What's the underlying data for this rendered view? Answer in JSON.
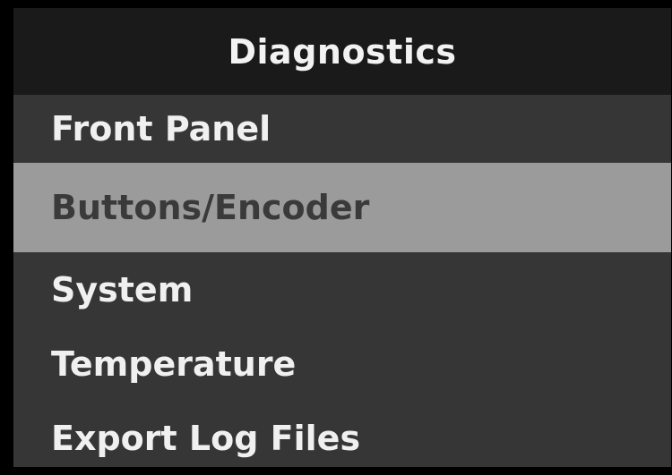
{
  "header": {
    "title": "Diagnostics"
  },
  "menu": {
    "items": [
      {
        "label": "Front Panel"
      },
      {
        "label": "Buttons/Encoder",
        "selected": true
      },
      {
        "label": "System"
      },
      {
        "label": "Temperature"
      },
      {
        "label": "Export Log Files"
      }
    ]
  },
  "colors": {
    "background": "#000000",
    "panel": "#363636",
    "header": "#1a1a1a",
    "selected": "#9b9b9b",
    "text": "#f0f0f0",
    "selected_text": "#3a3a3a"
  }
}
